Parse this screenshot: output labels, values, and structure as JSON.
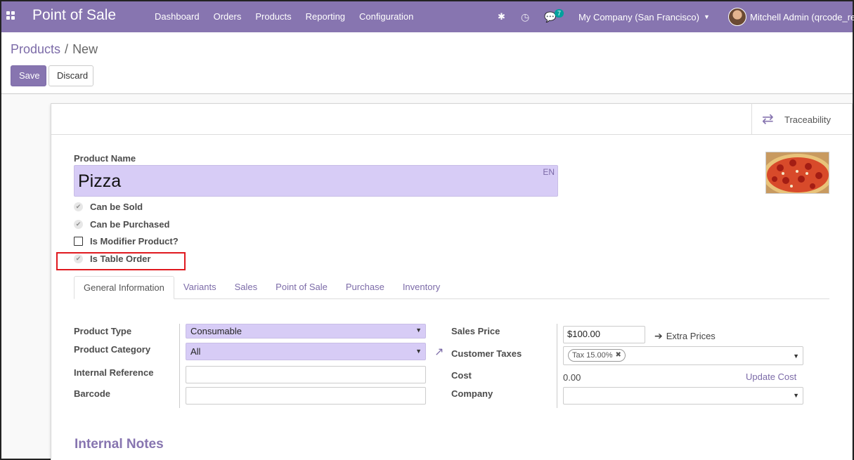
{
  "navbar": {
    "brand": "Point of Sale",
    "menu": [
      "Dashboard",
      "Orders",
      "Products",
      "Reporting",
      "Configuration"
    ],
    "chat_count": "7",
    "company": "My Company (San Francisco)",
    "user": "Mitchell Admin (qrcode_re"
  },
  "breadcrumb": {
    "parent": "Products",
    "current": "New"
  },
  "actions": {
    "save": "Save",
    "discard": "Discard"
  },
  "smart_button": {
    "traceability": "Traceability"
  },
  "form": {
    "product_name_label": "Product Name",
    "product_name": "Pizza",
    "lang": "EN",
    "checkboxes": [
      {
        "label": "Can be Sold",
        "checked": true
      },
      {
        "label": "Can be Purchased",
        "checked": true
      },
      {
        "label": "Is Modifier Product?",
        "checked": false
      },
      {
        "label": "Is Table Order",
        "checked": true
      }
    ]
  },
  "tabs": [
    "General Information",
    "Variants",
    "Sales",
    "Point of Sale",
    "Purchase",
    "Inventory"
  ],
  "general": {
    "product_type_label": "Product Type",
    "product_type": "Consumable",
    "product_category_label": "Product Category",
    "product_category": "All",
    "internal_reference_label": "Internal Reference",
    "internal_reference": "",
    "barcode_label": "Barcode",
    "barcode": "",
    "sales_price_label": "Sales Price",
    "sales_price": "$100.00",
    "extra_prices": "Extra Prices",
    "customer_taxes_label": "Customer Taxes",
    "tax_tag": "Tax 15.00%",
    "cost_label": "Cost",
    "cost": "0.00",
    "update_cost": "Update Cost",
    "company_label": "Company",
    "company": ""
  },
  "notes": {
    "title": "Internal Notes"
  }
}
